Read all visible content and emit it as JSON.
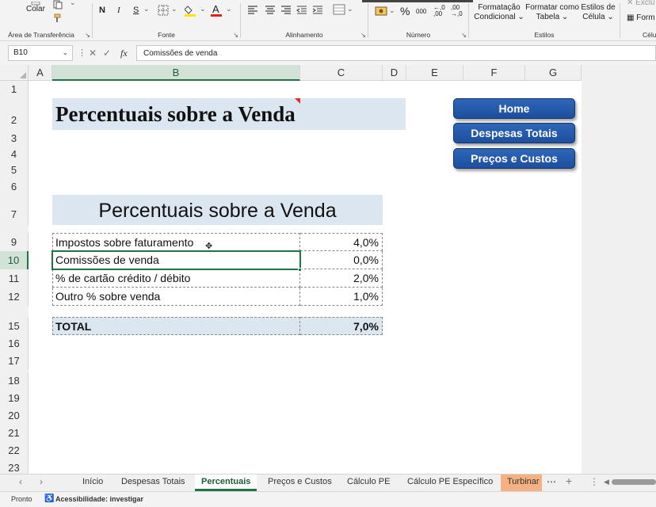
{
  "ribbon": {
    "clipboard": {
      "paste_label": "Colar",
      "group_label": "Área de Transferência"
    },
    "font": {
      "bold": "N",
      "italic": "I",
      "underline": "S",
      "group_label": "Fonte"
    },
    "alignment": {
      "group_label": "Alinhamento"
    },
    "number": {
      "percent": "%",
      "thousands": "000",
      "dec_increase": "←,0 ,00",
      "dec_decrease": ",00 →,0",
      "group_label": "Número"
    },
    "styles": {
      "conditional": "Formatação Condicional",
      "format_table": "Formatar como Tabela",
      "cell_styles": "Estilos de Célula",
      "group_label": "Estilos"
    },
    "cells": {
      "delete": "Exclu",
      "format": "Form",
      "group_label": "Célu"
    }
  },
  "formula_bar": {
    "name_box": "B10",
    "fx": "fx",
    "content": "Comissões de venda"
  },
  "columns": [
    "A",
    "B",
    "C",
    "D",
    "E",
    "F",
    "G"
  ],
  "rows": [
    "1",
    "2",
    "3",
    "4",
    "5",
    "6",
    "7",
    "9",
    "10",
    "11",
    "12",
    "15",
    "16",
    "17",
    "18",
    "19",
    "20",
    "21",
    "22",
    "23"
  ],
  "sheet": {
    "title_top": "Percentuais sobre a Venda",
    "title_table": "Percentuais sobre a Venda",
    "nav_buttons": [
      "Home",
      "Despesas Totais",
      "Preços e Custos"
    ],
    "table": [
      {
        "label": "Impostos sobre faturamento",
        "value": "4,0%"
      },
      {
        "label": "Comissões de venda",
        "value": "0,0%"
      },
      {
        "label": "% de cartão crédito / débito",
        "value": "2,0%"
      },
      {
        "label": "Outro % sobre venda",
        "value": "1,0%"
      }
    ],
    "total": {
      "label": "TOTAL",
      "value": "7,0%"
    }
  },
  "tabs": [
    "Início",
    "Despesas Totais",
    "Percentuais",
    "Preços e Custos",
    "Cálculo PE",
    "Cálculo PE Específico",
    "Turbinar"
  ],
  "active_tab": "Percentuais",
  "status": {
    "ready": "Pronto",
    "accessibility": "Acessibilidade: investigar"
  },
  "colors": {
    "accent": "#217346",
    "title_fill": "#dce6f1",
    "button": "#2459aa",
    "orange_tab": "#f4b183"
  }
}
